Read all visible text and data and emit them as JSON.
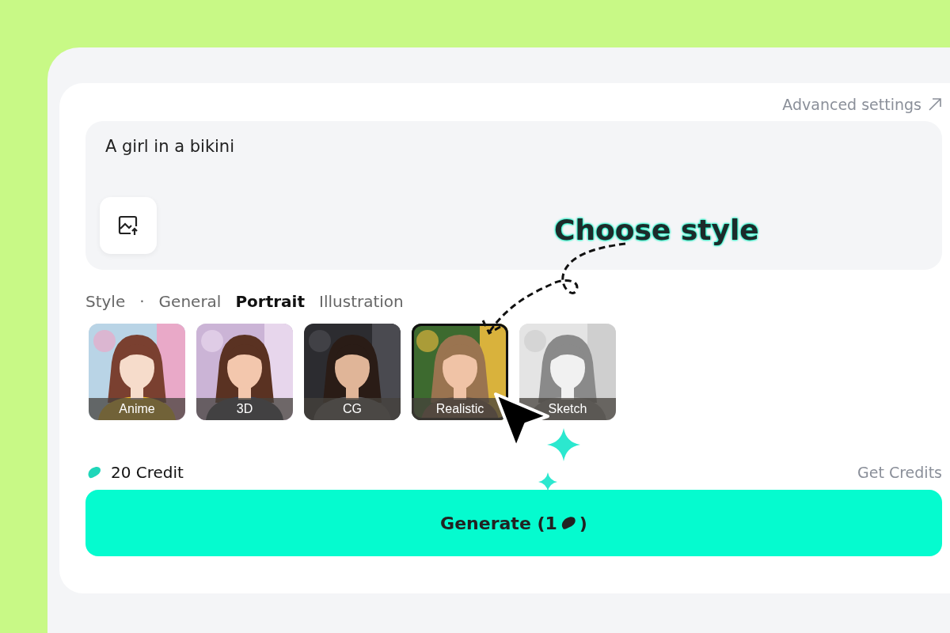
{
  "advanced_settings": "Advanced settings",
  "prompt": {
    "value": "A girl in a bikini"
  },
  "style_tabs": {
    "label": "Style",
    "separator": "·",
    "tabs": [
      {
        "label": "General",
        "selected": false
      },
      {
        "label": "Portrait",
        "selected": true
      },
      {
        "label": "Illustration",
        "selected": false
      }
    ]
  },
  "styles": [
    {
      "label": "Anime",
      "selected": false,
      "kind": "picture"
    },
    {
      "label": "3D",
      "selected": false,
      "kind": "picture"
    },
    {
      "label": "CG",
      "selected": false,
      "kind": "picture"
    },
    {
      "label": "Realistic",
      "selected": true,
      "kind": "picture"
    },
    {
      "label": "Sketch",
      "selected": false,
      "kind": "picture"
    }
  ],
  "credits": {
    "balance": "20 Credit",
    "link": "Get Credits"
  },
  "generate": {
    "label_before": "Generate (1",
    "label_after": ")"
  },
  "annotation": {
    "text": "Choose style"
  }
}
